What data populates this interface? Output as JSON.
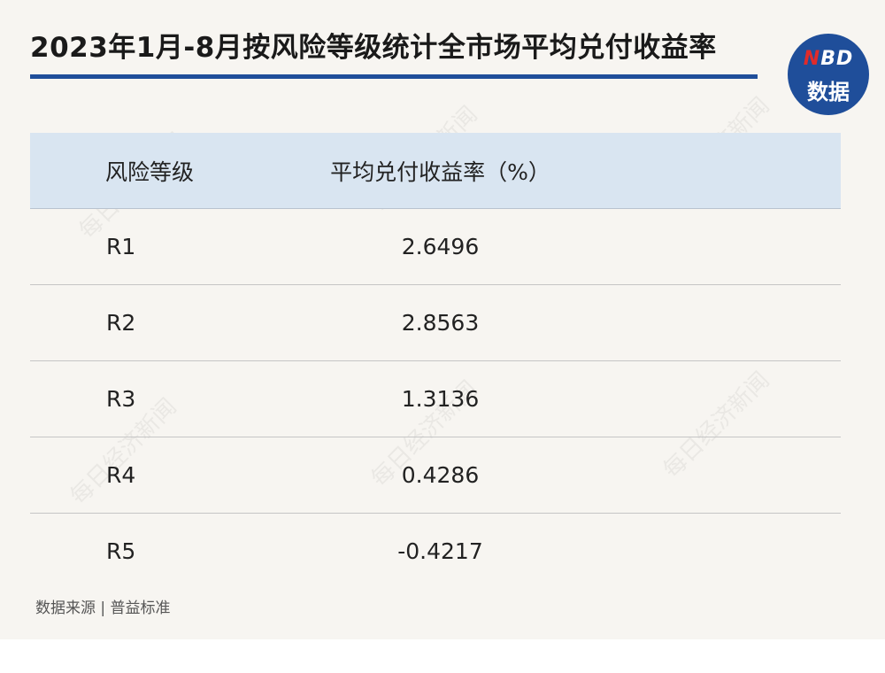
{
  "header": {
    "title": "2023年1月-8月按风险等级统计全市场平均兑付收益率"
  },
  "logo": {
    "brand_n": "N",
    "brand_rest": "BD",
    "label": "数据"
  },
  "table": {
    "columns": [
      "风险等级",
      "平均兑付收益率（%）"
    ],
    "rows": [
      {
        "level": "R1",
        "yield": "2.6496"
      },
      {
        "level": "R2",
        "yield": "2.8563"
      },
      {
        "level": "R3",
        "yield": "1.3136"
      },
      {
        "level": "R4",
        "yield": "0.4286"
      },
      {
        "level": "R5",
        "yield": "-0.4217"
      }
    ]
  },
  "footer": {
    "source": "数据来源 | 普益标准"
  },
  "watermark": "每日经济新闻",
  "colors": {
    "accent": "#1f4e9a",
    "header_bg": "#d9e5f1",
    "page_bg": "#f7f5f1",
    "logo_highlight": "#e02b2b"
  }
}
